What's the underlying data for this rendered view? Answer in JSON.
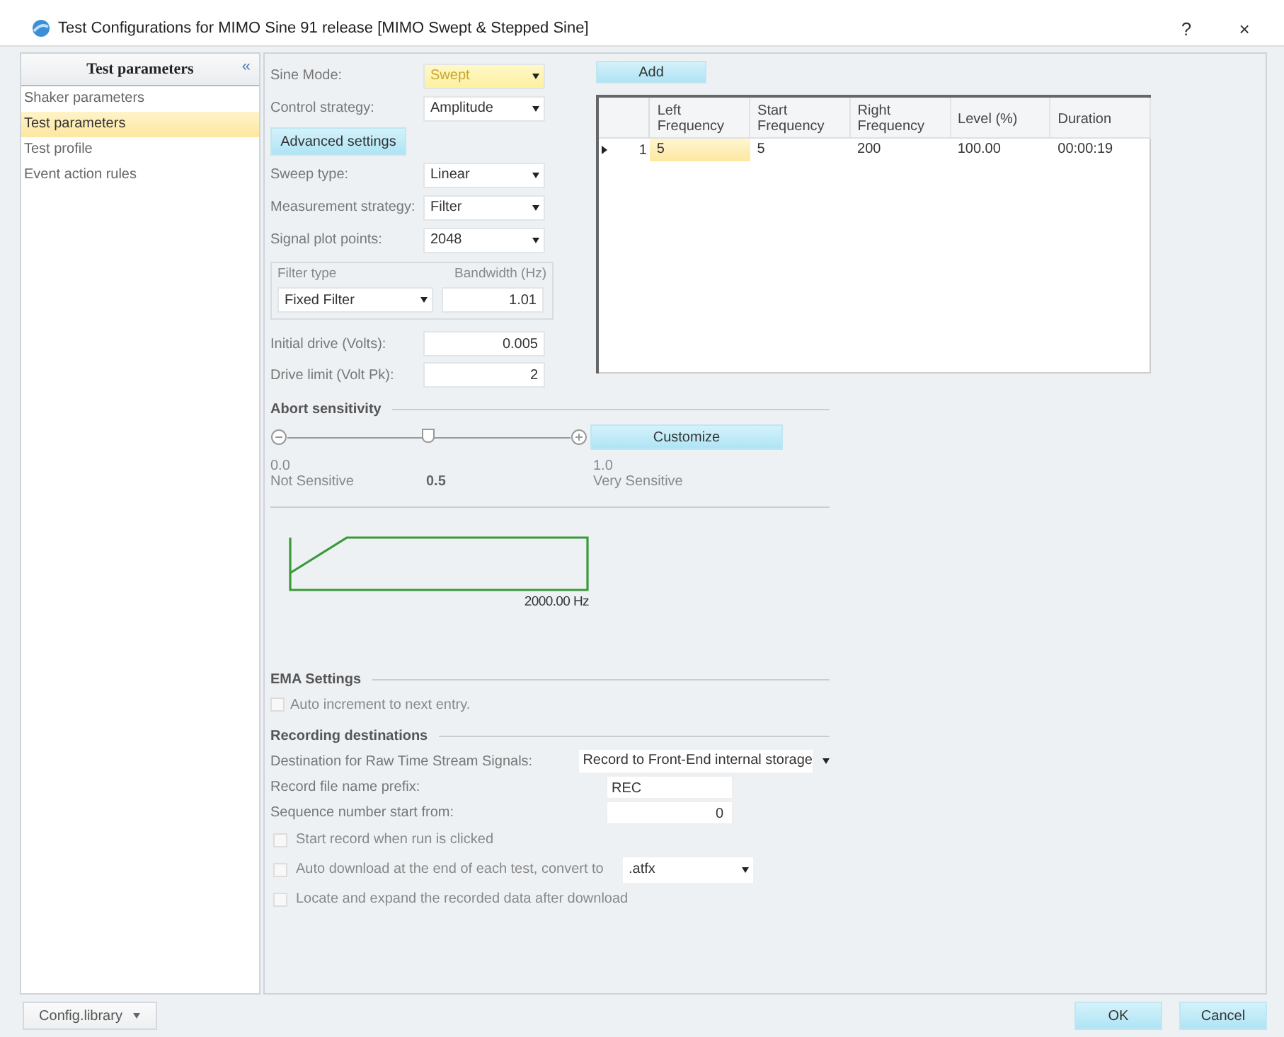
{
  "window": {
    "title": "Test Configurations for MIMO Sine 91 release [MIMO Swept & Stepped Sine]",
    "help": "?",
    "close": "×"
  },
  "sidebar": {
    "header": "Test parameters",
    "collapse": "«",
    "items": [
      {
        "label": "Shaker parameters",
        "selected": false
      },
      {
        "label": "Test parameters",
        "selected": true
      },
      {
        "label": "Test profile",
        "selected": false
      },
      {
        "label": "Event action rules",
        "selected": false
      }
    ]
  },
  "form": {
    "top_fields": [
      {
        "label": "Sine Mode:",
        "value": "Swept",
        "highlighted": true
      },
      {
        "label": "Control strategy:",
        "value": "Amplitude",
        "highlighted": false
      }
    ],
    "advanced_button": "Advanced settings",
    "fields": [
      {
        "label": "Sweep type:",
        "value": "Linear"
      },
      {
        "label": "Measurement strategy:",
        "value": "Filter"
      },
      {
        "label": "Signal plot points:",
        "value": "2048"
      }
    ],
    "filter_type": {
      "label": "Filter type",
      "value": "Fixed Filter"
    },
    "bandwidth": {
      "label": "Bandwidth (Hz)",
      "value": "1.01"
    },
    "drive_fields": [
      {
        "label": "Initial drive (Volts):",
        "value": "0.005"
      },
      {
        "label": "Drive limit (Volt Pk):",
        "value": "2"
      }
    ]
  },
  "add_button": "Add",
  "table": {
    "columns": [
      "Left Frequency",
      "Start Frequency",
      "Right Frequency",
      "Level (%)",
      "Duration"
    ],
    "rows": [
      {
        "index": "1",
        "current": true,
        "cells": [
          {
            "text": "5",
            "selected": true
          },
          {
            "text": "5",
            "selected": false
          },
          {
            "text": "200",
            "selected": false
          },
          {
            "text": "100.00",
            "selected": false
          },
          {
            "text": "00:00:19",
            "selected": false
          }
        ]
      }
    ]
  },
  "abort": {
    "title": "Abort sensitivity",
    "level": 0.5,
    "min_value": "0.0",
    "min_caption": "Not Sensitive",
    "mid_value": "0.5",
    "max_value": "1.0",
    "max_caption": "Very Sensitive",
    "customize_button": "Customize"
  },
  "profile": {
    "axis_label": "2000.00 Hz"
  },
  "ema": {
    "title": "EMA Settings",
    "options": [
      {
        "label": "Auto increment to next entry.",
        "checked": false
      }
    ]
  },
  "recording": {
    "title": "Recording destinations",
    "rows": [
      {
        "kind": "combo",
        "label": "Destination for Raw Time Stream Signals:",
        "value": "Record to Front-End internal storage"
      },
      {
        "kind": "text",
        "label": "Record file name prefix:",
        "value": "REC"
      },
      {
        "kind": "number",
        "label": "Sequence number start from:",
        "value": "0"
      },
      {
        "kind": "checkbox",
        "label": "Start record when run is clicked",
        "checked": false
      },
      {
        "kind": "checkbox_combo",
        "label": "Auto download at the end of each test, convert to",
        "checked": false,
        "value": ".atfx"
      },
      {
        "kind": "checkbox",
        "label": "Locate and expand the recorded data after download",
        "checked": false
      }
    ]
  },
  "footer": {
    "library_button": "Config.library",
    "ok": "OK",
    "cancel": "Cancel"
  }
}
